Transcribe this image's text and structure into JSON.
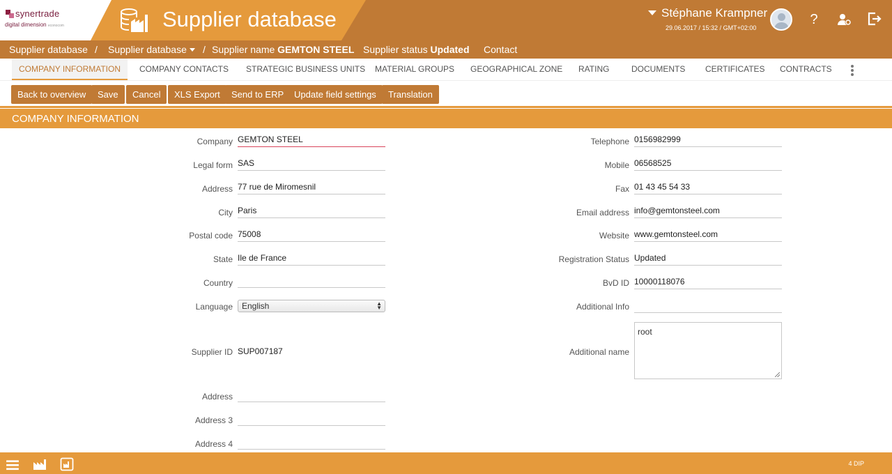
{
  "brand": {
    "logo_name": "synertrade",
    "logo_sub": "digital dimension",
    "logo_small": "econocom"
  },
  "header": {
    "app_title": "Supplier database",
    "user_name": "Stéphane Krampner",
    "user_datetime": "29.06.2017 / 15:32 / GMT+02:00",
    "help_icon_glyph": "?"
  },
  "breadcrumb": {
    "root": "Supplier database",
    "sep": "/",
    "module": "Supplier database",
    "supplier_name_label": "Supplier name",
    "supplier_name_value": "GEMTON STEEL",
    "supplier_status_label": "Supplier status",
    "supplier_status_value": "Updated",
    "contact": "Contact"
  },
  "tabs": [
    {
      "label": "COMPANY INFORMATION",
      "active": true
    },
    {
      "label": "COMPANY CONTACTS"
    },
    {
      "label": "STRATEGIC BUSINESS UNITS"
    },
    {
      "label": "MATERIAL GROUPS"
    },
    {
      "label": "GEOGRAPHICAL ZONE"
    },
    {
      "label": "RATING"
    },
    {
      "label": "DOCUMENTS"
    },
    {
      "label": "CERTIFICATES"
    },
    {
      "label": "CONTRACTS"
    }
  ],
  "actions": {
    "back": "Back to overview",
    "save": "Save",
    "cancel": "Cancel",
    "xls": "XLS Export",
    "erp": "Send to ERP",
    "update_fields": "Update field settings",
    "translation": "Translation"
  },
  "section_title": "COMPANY INFORMATION",
  "form_left": {
    "company": {
      "label": "Company",
      "value": "GEMTON STEEL"
    },
    "legal_form": {
      "label": "Legal form",
      "value": "SAS"
    },
    "address": {
      "label": "Address",
      "value": "77 rue de Miromesnil"
    },
    "city": {
      "label": "City",
      "value": "Paris"
    },
    "postal_code": {
      "label": "Postal code",
      "value": "75008"
    },
    "state": {
      "label": "State",
      "value": "Ile de France"
    },
    "country": {
      "label": "Country",
      "value": ""
    },
    "language": {
      "label": "Language",
      "value": "English"
    },
    "supplier_id": {
      "label": "Supplier ID",
      "value": "SUP007187"
    },
    "address2": {
      "label": "Address",
      "value": ""
    },
    "address3": {
      "label": "Address 3",
      "value": ""
    },
    "address4": {
      "label": "Address 4",
      "value": ""
    }
  },
  "form_right": {
    "telephone": {
      "label": "Telephone",
      "value": "0156982999"
    },
    "mobile": {
      "label": "Mobile",
      "value": "06568525"
    },
    "fax": {
      "label": "Fax",
      "value": "01 43 45 54 33"
    },
    "email": {
      "label": "Email address",
      "value": "info@gemtonsteel.com"
    },
    "website": {
      "label": "Website",
      "value": "www.gemtonsteel.com"
    },
    "registration_status": {
      "label": "Registration Status",
      "value": "Updated"
    },
    "bvd_id": {
      "label": "BvD ID",
      "value": "10000118076"
    },
    "additional_info": {
      "label": "Additional Info",
      "value": ""
    },
    "additional_name": {
      "label": "Additional name",
      "value": "root"
    }
  },
  "footer": {
    "version": "4 DIP"
  },
  "colors": {
    "dark_orange": "#c07a35",
    "orange": "#e59a3c",
    "brand_purple": "#7a2040"
  }
}
